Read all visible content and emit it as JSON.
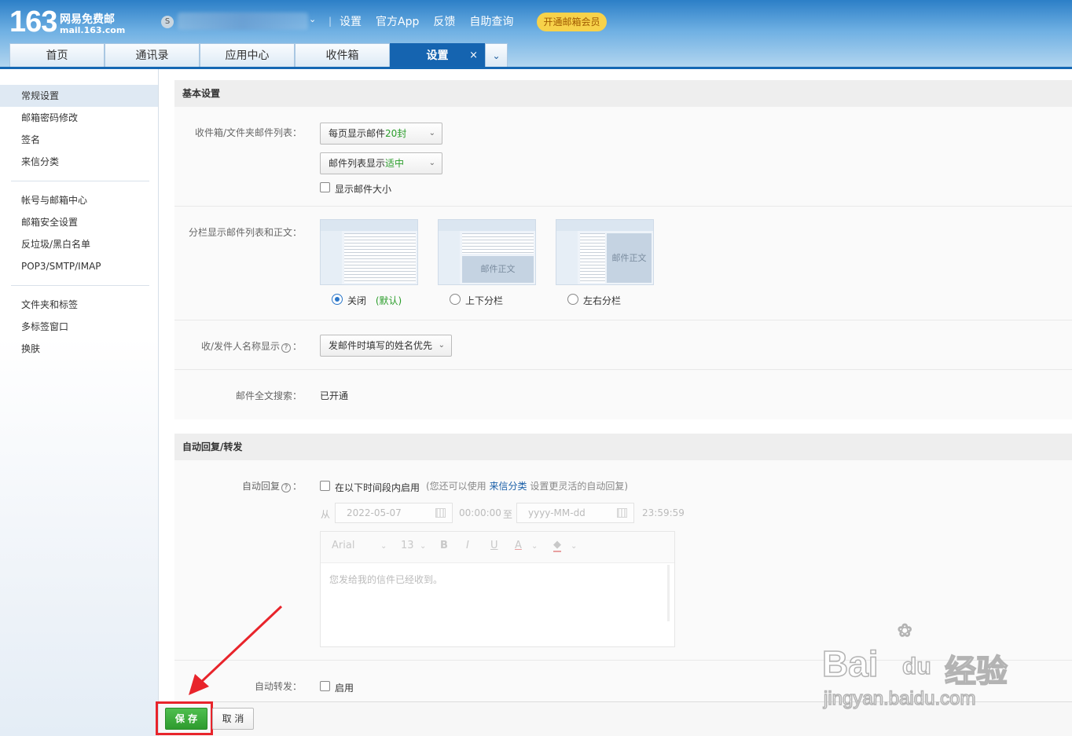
{
  "logo": {
    "number": "163",
    "name": "网易免费邮",
    "domain": "mail.163.com"
  },
  "topbar": {
    "links": [
      "设置",
      "官方App",
      "反馈",
      "自助查询"
    ],
    "vip_label": "开通邮箱会员",
    "coin_icon": "S"
  },
  "tabs": [
    {
      "label": "首页"
    },
    {
      "label": "通讯录"
    },
    {
      "label": "应用中心"
    },
    {
      "label": "收件箱"
    },
    {
      "label": "设置",
      "active": true,
      "close": "×"
    }
  ],
  "tab_more": "⌄",
  "sidebar": {
    "group1": [
      "常规设置",
      "邮箱密码修改",
      "签名",
      "来信分类"
    ],
    "group2": [
      "帐号与邮箱中心",
      "邮箱安全设置",
      "反垃圾/黑白名单",
      "POP3/SMTP/IMAP"
    ],
    "group3": [
      "文件夹和标签",
      "多标签窗口",
      "换肤"
    ]
  },
  "basic": {
    "title": "基本设置",
    "list_label": "收件箱/文件夹邮件列表：",
    "per_page_prefix": "每页显示邮件",
    "per_page_value": "20封",
    "density_prefix": "邮件列表显示",
    "density_value": "适中",
    "show_size": "显示邮件大小",
    "split_label": "分栏显示邮件列表和正文：",
    "preview_body": "邮件正文",
    "split_off": "关闭",
    "split_default": "(默认)",
    "split_tb": "上下分栏",
    "split_lr": "左右分栏",
    "sender_label": "收/发件人名称显示",
    "sender_value": "发邮件时填写的姓名优先",
    "search_label": "邮件全文搜索：",
    "search_value": "已开通",
    "help_icon": "?"
  },
  "auto": {
    "title": "自动回复/转发",
    "reply_label": "自动回复",
    "reply_enable": "在以下时间段内启用",
    "reply_hint_pre": "(您还可以使用",
    "reply_hint_link": "来信分类",
    "reply_hint_post": "设置更灵活的自动回复)",
    "from": "从",
    "start_date": "2022-05-07",
    "start_time": "00:00:00",
    "to": "至",
    "end_placeholder": "yyyy-MM-dd",
    "end_time": "23:59:59",
    "font": "Arial",
    "size": "13",
    "bold": "B",
    "italic": "I",
    "underline": "U",
    "color": "A",
    "reply_text": "您发给我的信件已经收到。",
    "forward_label": "自动转发：",
    "forward_enable": "启用"
  },
  "footer": {
    "save": "保 存",
    "cancel": "取 消"
  },
  "watermark": {
    "brand": "Bai",
    "brand2": "du",
    "cn": "经验",
    "url": "jingyan.baidu.com"
  },
  "colors": {
    "header": "#2c7fc7",
    "active_tab": "#1564b0",
    "save": "#2e9b2e",
    "highlight": "#e8242b",
    "link": "#1a5fa8"
  }
}
